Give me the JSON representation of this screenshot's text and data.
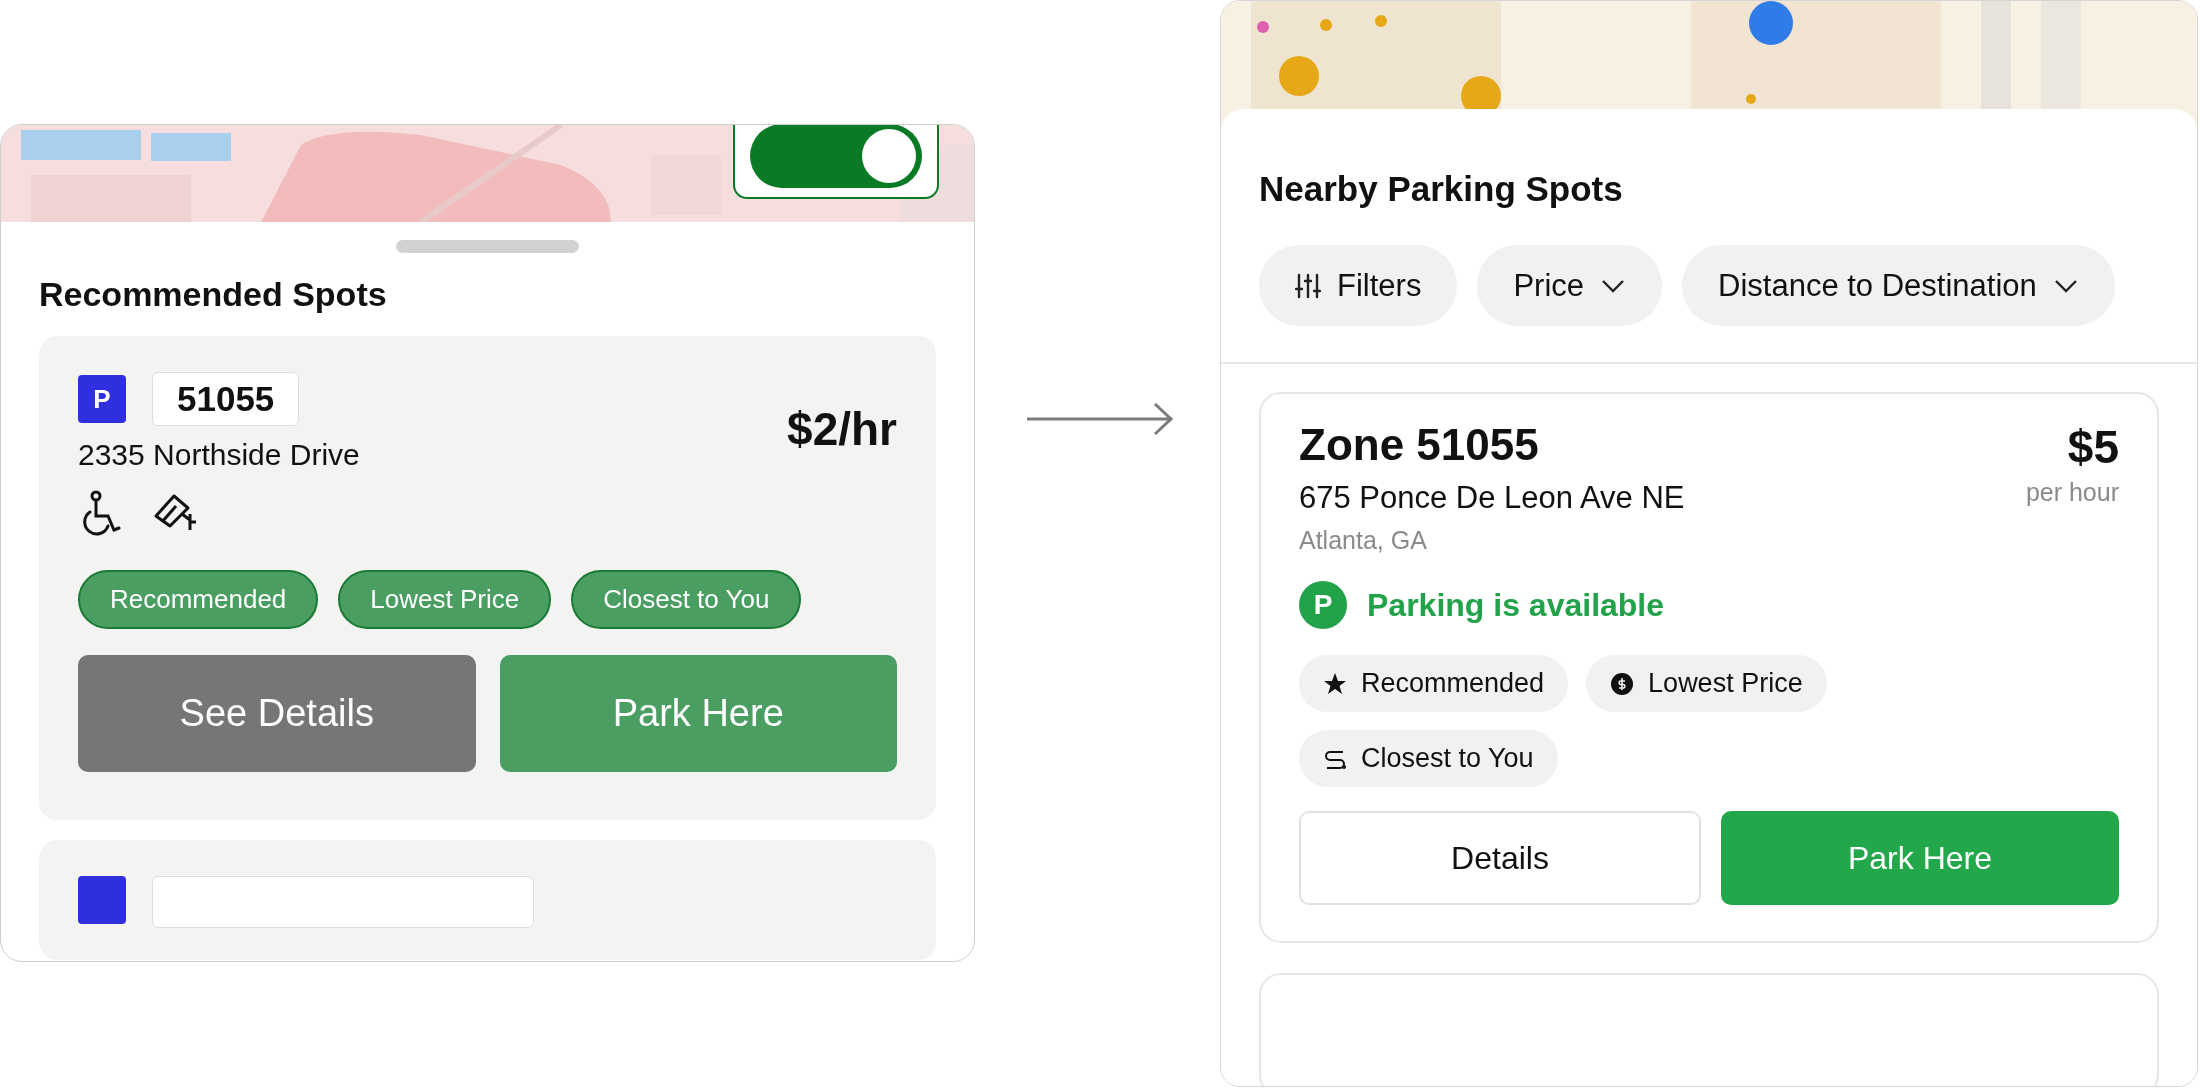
{
  "before": {
    "toggle": {
      "on": true
    },
    "title": "Recommended Spots",
    "spot": {
      "badge": "P",
      "number": "51055",
      "address": "2335 Northside Drive",
      "price": "$2/hr",
      "amenities": [
        {
          "kind": "wheelchair"
        },
        {
          "kind": "camera"
        }
      ],
      "tags": [
        "Recommended",
        "Lowest Price",
        "Closest to You"
      ],
      "buttons": [
        {
          "label": "See Details",
          "kind": "secondary"
        },
        {
          "label": "Park Here",
          "kind": "primary"
        }
      ]
    }
  },
  "after": {
    "title": "Nearby Parking Spots",
    "chips": [
      {
        "label": "Filters",
        "kind": "filters"
      },
      {
        "label": "Price",
        "kind": "dropdown"
      },
      {
        "label": "Distance to Destination",
        "kind": "dropdown"
      }
    ],
    "spot": {
      "zone": "Zone 51055",
      "address": "675 Ponce De Leon Ave NE",
      "city": "Atlanta, GA",
      "price": "$5",
      "unit": "per hour",
      "status": {
        "badge": "P",
        "text": "Parking is available",
        "available": true
      },
      "tags": [
        {
          "label": "Recommended",
          "kind": "star"
        },
        {
          "label": "Lowest Price",
          "kind": "coin"
        },
        {
          "label": "Closest to You",
          "kind": "route"
        }
      ],
      "buttons": [
        {
          "label": "Details",
          "kind": "secondary"
        },
        {
          "label": "Park Here",
          "kind": "primary"
        }
      ]
    }
  }
}
